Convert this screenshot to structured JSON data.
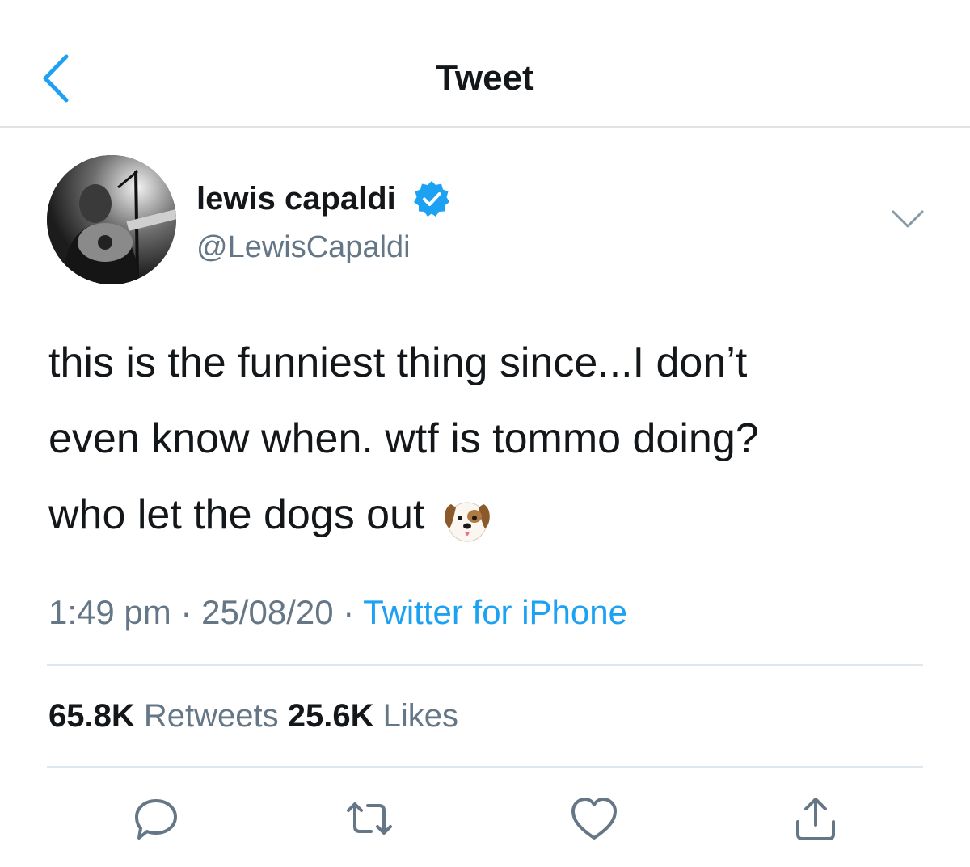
{
  "nav": {
    "title": "Tweet"
  },
  "tweet": {
    "author": {
      "name": "lewis capaldi",
      "handle": "@LewisCapaldi",
      "verified": true
    },
    "text": "this is the funniest thing since...I don’t\neven know when. wtf is tommo doing?\nwho let the dogs out ",
    "emoji": "dog-face",
    "time": "1:49 pm",
    "date": "25/08/20",
    "source": "Twitter for iPhone",
    "retweets": {
      "count": "65.8K",
      "label": "Retweets"
    },
    "likes": {
      "count": "25.6K",
      "label": "Likes"
    }
  },
  "colors": {
    "accent": "#1da1f2",
    "secondary_text": "#657786",
    "divider": "#e1e8ed"
  },
  "icons": [
    "back-chevron-icon",
    "verified-badge-icon",
    "caret-down-icon",
    "reply-icon",
    "retweet-icon",
    "like-icon",
    "share-icon"
  ]
}
